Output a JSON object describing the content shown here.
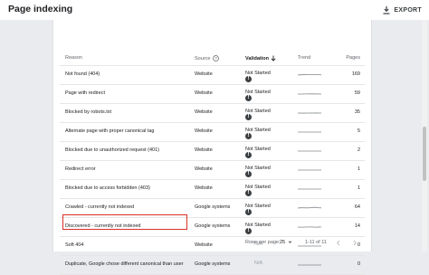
{
  "header": {
    "title": "Page indexing",
    "export_label": "EXPORT"
  },
  "table": {
    "columns": {
      "reason": "Reason",
      "source": "Source",
      "validation": "Validation",
      "trend": "Trend",
      "pages": "Pages"
    },
    "rows": [
      {
        "reason": "Not found (404)",
        "source": "Website",
        "validation": "Not Started",
        "pages": "169"
      },
      {
        "reason": "Page with redirect",
        "source": "Website",
        "validation": "Not Started",
        "pages": "59"
      },
      {
        "reason": "Blocked by robots.txt",
        "source": "Website",
        "validation": "Not Started",
        "pages": "35"
      },
      {
        "reason": "Alternate page with proper canonical tag",
        "source": "Website",
        "validation": "Not Started",
        "pages": "5"
      },
      {
        "reason": "Blocked due to unauthorized request (401)",
        "source": "Website",
        "validation": "Not Started",
        "pages": "2"
      },
      {
        "reason": "Redirect error",
        "source": "Website",
        "validation": "Not Started",
        "pages": "1"
      },
      {
        "reason": "Blocked due to access forbidden (403)",
        "source": "Website",
        "validation": "Not Started",
        "pages": "1"
      },
      {
        "reason": "Crawled - currently not indexed",
        "source": "Google systems",
        "validation": "Not Started",
        "pages": "64"
      },
      {
        "reason": "Discovered - currently not indexed",
        "source": "Google systems",
        "validation": "Not Started",
        "pages": "14"
      },
      {
        "reason": "Soft 404",
        "source": "Website",
        "validation": "N/A",
        "pages": "0"
      },
      {
        "reason": "Duplicate, Google chose different canonical than user",
        "source": "Google systems",
        "validation": "N/A",
        "pages": "0"
      }
    ]
  },
  "footer": {
    "rows_per_page_label": "Rows per page:",
    "rows_per_page_value": "25",
    "range": "1-11 of 11"
  },
  "colors": {
    "highlight": "#d93025"
  }
}
